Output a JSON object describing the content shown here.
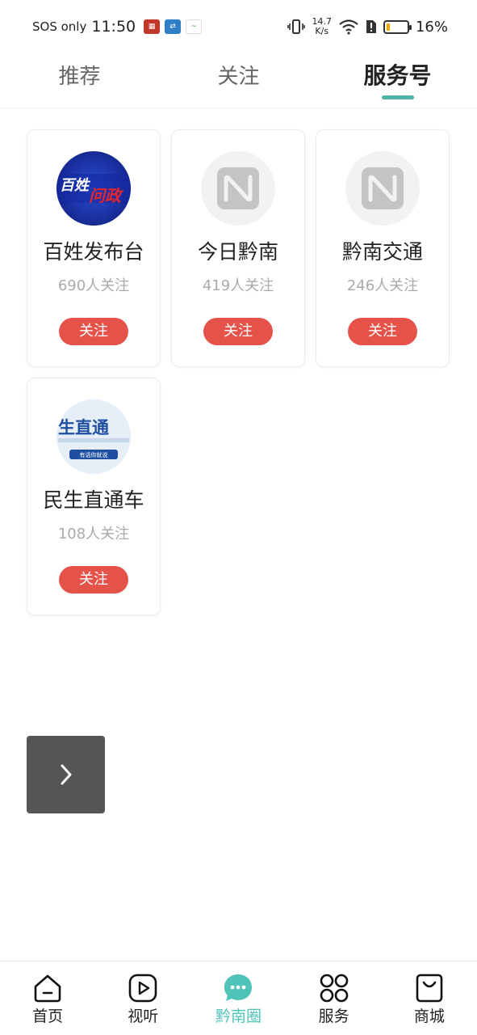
{
  "status_bar": {
    "sos": "SOS only",
    "time": "11:50",
    "speed_value": "14.7",
    "speed_unit": "K/s",
    "battery_pct": "16%",
    "battery_level": 0.16
  },
  "tabs": [
    {
      "label": "推荐",
      "active": false
    },
    {
      "label": "关注",
      "active": false
    },
    {
      "label": "服务号",
      "active": true
    }
  ],
  "accounts": [
    {
      "name": "百姓发布台",
      "followers": "690人关注",
      "follow_label": "关注",
      "avatar_text": "百姓问政"
    },
    {
      "name": "今日黔南",
      "followers": "419人关注",
      "follow_label": "关注"
    },
    {
      "name": "黔南交通",
      "followers": "246人关注",
      "follow_label": "关注"
    },
    {
      "name": "民生直通车",
      "followers": "108人关注",
      "follow_label": "关注",
      "avatar_text": "生直通",
      "avatar_subtext": "有话你就说"
    }
  ],
  "bottom_nav": [
    {
      "label": "首页",
      "icon": "home-icon",
      "active": false
    },
    {
      "label": "视听",
      "icon": "play-icon",
      "active": false
    },
    {
      "label": "黔南圈",
      "icon": "chat-bubble-icon",
      "active": true
    },
    {
      "label": "服务",
      "icon": "grid-icon",
      "active": false
    },
    {
      "label": "商城",
      "icon": "shopping-bag-icon",
      "active": false
    }
  ],
  "colors": {
    "accent": "#4fc3b8",
    "tab_indicator": "#4fb3a8",
    "follow_button": "#e5524a",
    "float_button": "#555555"
  }
}
